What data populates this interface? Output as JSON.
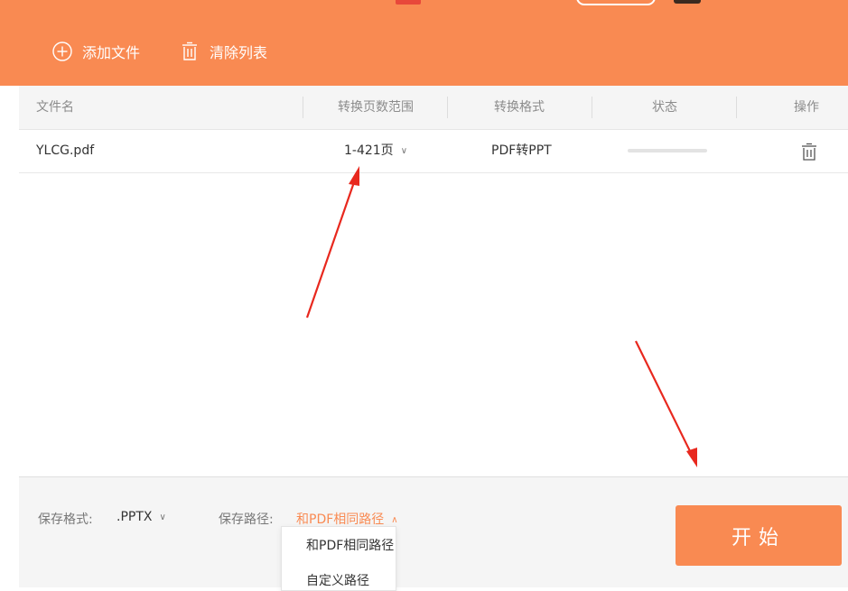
{
  "toolbar": {
    "add_label": "添加文件",
    "clear_label": "清除列表"
  },
  "table": {
    "headers": {
      "filename": "文件名",
      "page_range": "转换页数范围",
      "format": "转换格式",
      "status": "状态",
      "action": "操作"
    },
    "rows": [
      {
        "filename": "YLCG.pdf",
        "page_range": "1-421页",
        "format": "PDF转PPT",
        "progress": 0
      }
    ]
  },
  "footer": {
    "save_format_label": "保存格式:",
    "save_format_value": ".PPTX",
    "save_path_label": "保存路径:",
    "save_path_value": "和PDF相同路径",
    "start_label": "开始",
    "path_options": [
      "和PDF相同路径",
      "自定义路径"
    ]
  },
  "colors": {
    "accent": "#f98a52",
    "annotation_arrow": "#e8281e"
  },
  "icons": [
    "plus-circle-icon",
    "trash-icon",
    "chevron-down-icon",
    "chevron-up-icon"
  ]
}
